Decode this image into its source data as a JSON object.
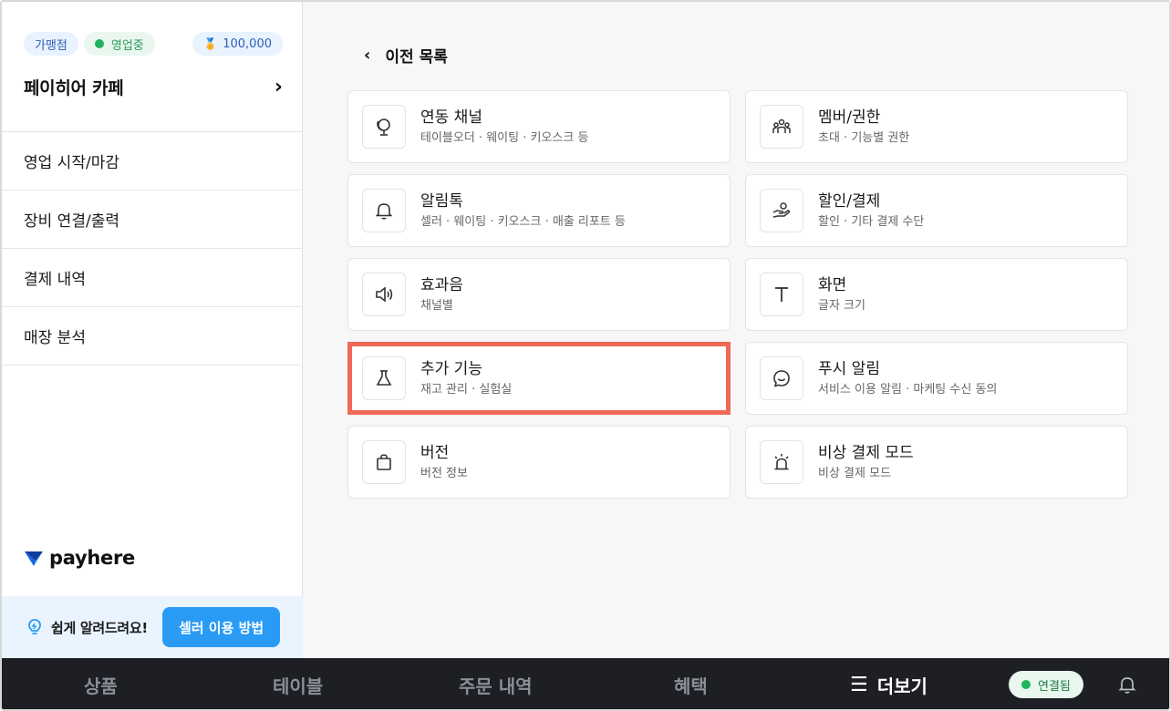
{
  "sidebar": {
    "badge_type": "가맹점",
    "badge_status": "영업중",
    "badge_points": "100,000",
    "store_name": "페이히어 카페",
    "menu": [
      "영업 시작/마감",
      "장비 연결/출력",
      "결제 내역",
      "매장 분석"
    ],
    "logo_text": "payhere",
    "help_text": "쉽게 알려드려요!",
    "help_button": "셀러 이용 방법"
  },
  "main": {
    "back_label": "이전 목록",
    "cards": [
      {
        "title": "연동 채널",
        "sub": "테이블오더 · 웨이팅 · 키오스크 등",
        "icon": "globe-icon"
      },
      {
        "title": "멤버/권한",
        "sub": "초대 · 기능별 권한",
        "icon": "members-icon"
      },
      {
        "title": "알림톡",
        "sub": "셀러 · 웨이팅 · 키오스크 · 매출 리포트 등",
        "icon": "bell-icon"
      },
      {
        "title": "할인/결제",
        "sub": "할인 · 기타 결제 수단",
        "icon": "hand-coin-icon"
      },
      {
        "title": "효과음",
        "sub": "채널별",
        "icon": "speaker-icon"
      },
      {
        "title": "화면",
        "sub": "글자 크기",
        "icon": "text-icon"
      },
      {
        "title": "추가 기능",
        "sub": "재고 관리 · 실험실",
        "icon": "flask-icon"
      },
      {
        "title": "푸시 알림",
        "sub": "서비스 이용 알림 · 마케팅 수신 동의",
        "icon": "chat-smile-icon"
      },
      {
        "title": "버전",
        "sub": "버전 정보",
        "icon": "bag-icon"
      },
      {
        "title": "비상 결제 모드",
        "sub": "비상 결제 모드",
        "icon": "siren-icon"
      }
    ]
  },
  "nav": {
    "items": [
      "상품",
      "테이블",
      "주문 내역",
      "혜택",
      "더보기"
    ],
    "connection": "연결됨"
  },
  "colors": {
    "accent": "#2a9bf5",
    "highlight": "#ee6a55",
    "nav_bg": "#1d1f24",
    "status_green": "#1fb35d"
  }
}
